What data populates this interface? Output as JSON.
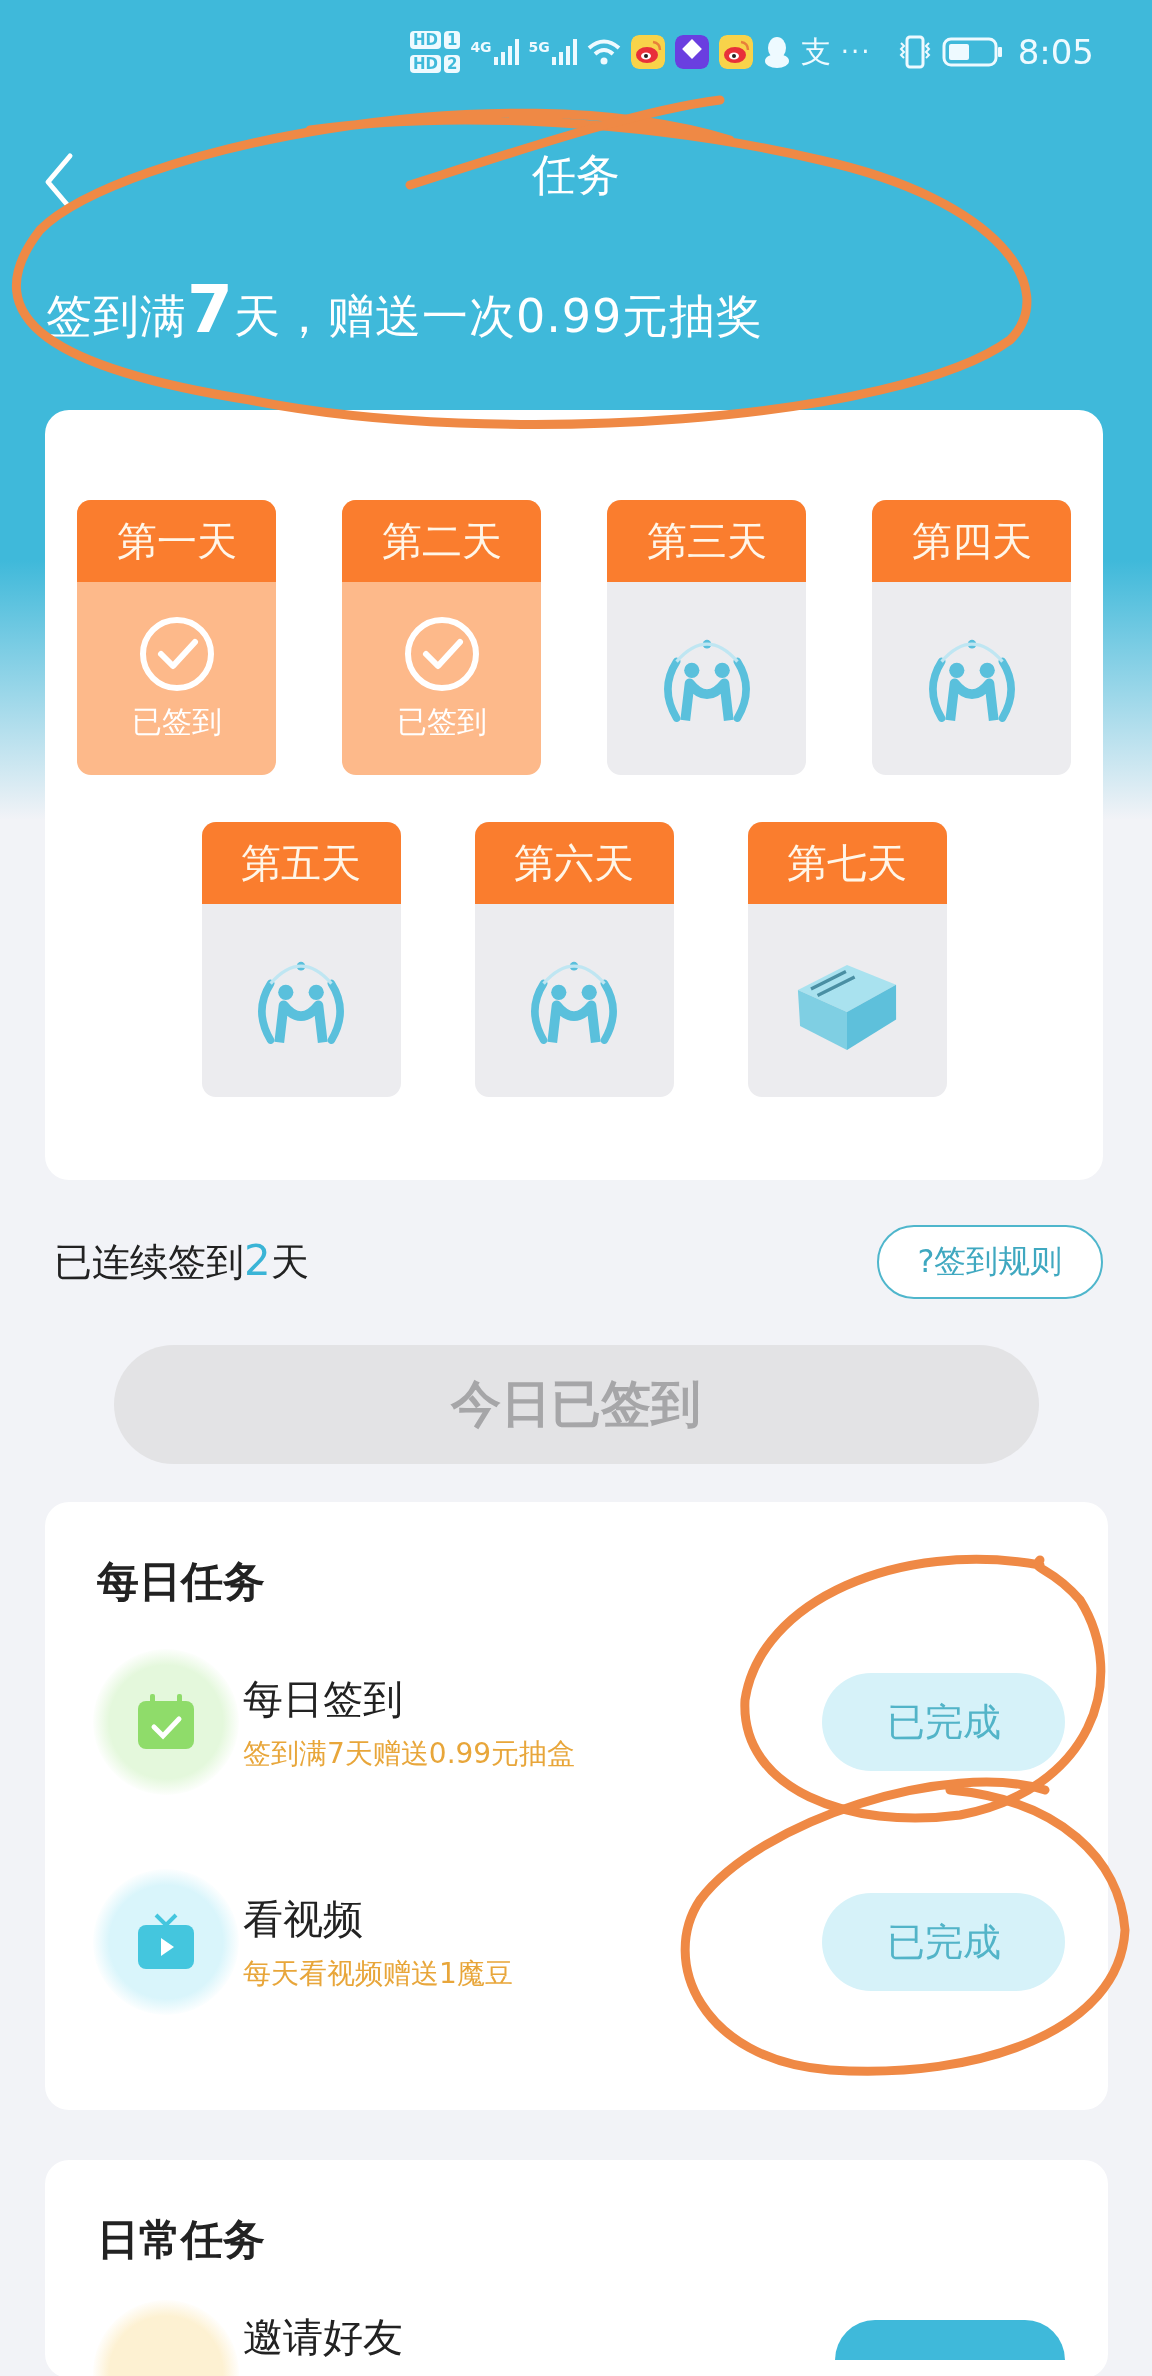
{
  "status_bar": {
    "sims": [
      {
        "label": "HD",
        "slot": "1"
      },
      {
        "label": "HD",
        "slot": "2"
      }
    ],
    "networks": [
      "4G",
      "5G"
    ],
    "pay_glyph": "支",
    "overflow": "···",
    "time": "8:05"
  },
  "header": {
    "title": "任务"
  },
  "banner": {
    "before": "签到满",
    "highlight": "7",
    "after": "天，赠送一次0.99元抽奖"
  },
  "days": [
    {
      "label": "第一天",
      "signed": true,
      "status": "已签到"
    },
    {
      "label": "第二天",
      "signed": true,
      "status": "已签到"
    },
    {
      "label": "第三天",
      "signed": false,
      "kind": "logo"
    },
    {
      "label": "第四天",
      "signed": false,
      "kind": "logo"
    },
    {
      "label": "第五天",
      "signed": false,
      "kind": "logo"
    },
    {
      "label": "第六天",
      "signed": false,
      "kind": "logo"
    },
    {
      "label": "第七天",
      "signed": false,
      "kind": "gift"
    }
  ],
  "streak": {
    "before": "已连续签到",
    "count": "2",
    "after": "天"
  },
  "rules_button": "?签到规则",
  "sign_button": {
    "label": "今日已签到",
    "disabled": true
  },
  "daily_tasks": {
    "title": "每日任务",
    "items": [
      {
        "kind": "calendar",
        "title": "每日签到",
        "desc": "签到满7天赠送0.99元抽盒",
        "button": "已完成",
        "done": true
      },
      {
        "kind": "video",
        "title": "看视频",
        "desc": "每天看视频赠送1魔豆",
        "button": "已完成",
        "done": true
      }
    ]
  },
  "routine_tasks": {
    "title": "日常任务",
    "items": [
      {
        "kind": "invite",
        "title": "邀请好友"
      }
    ]
  }
}
